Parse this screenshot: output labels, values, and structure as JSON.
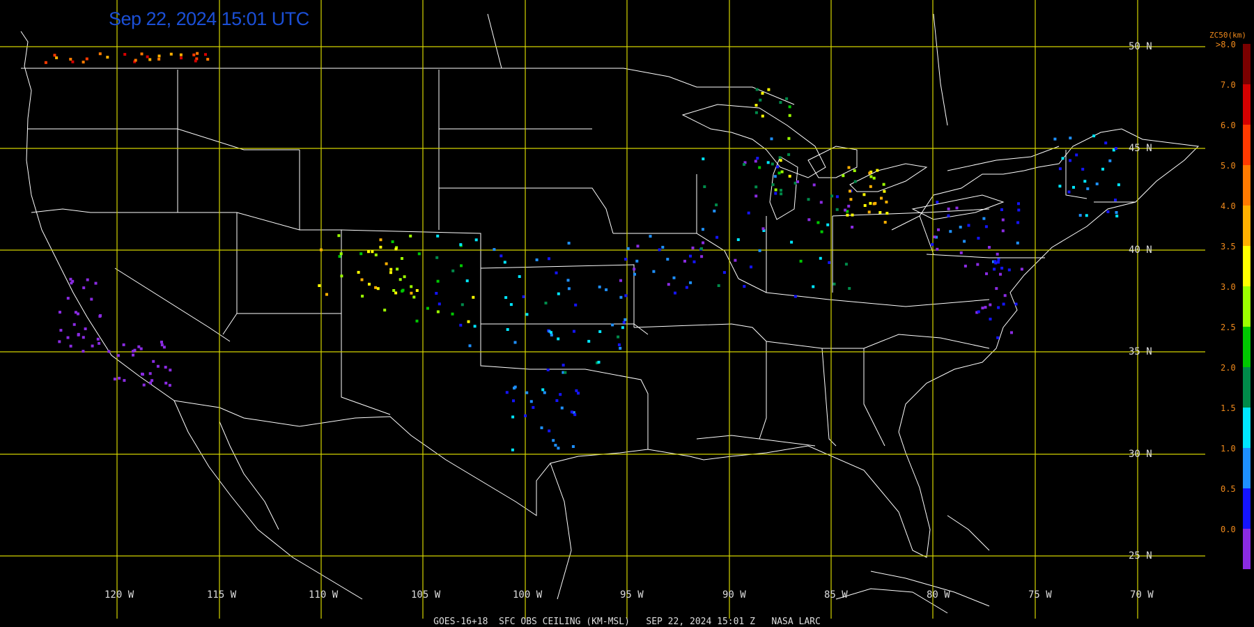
{
  "header": {
    "timestamp": "Sep 22, 2024 15:01 UTC"
  },
  "footer": {
    "caption": "GOES-16+18  SFC OBS CEILING (KM-MSL)   SEP 22, 2024 15:01 Z   NASA LARC"
  },
  "grid": {
    "lat_labels": [
      "50 N",
      "45 N",
      "40 N",
      "35 N",
      "30 N",
      "25 N"
    ],
    "lon_labels": [
      "120 W",
      "115 W",
      "110 W",
      "105 W",
      "100 W",
      "95 W",
      "90 W",
      "85 W",
      "80 W",
      "75 W",
      "70 W"
    ]
  },
  "legend": {
    "title": "ZC50(km)",
    "top_label": ">8.0",
    "labels": [
      "7.0",
      "6.0",
      "5.0",
      "4.0",
      "3.5",
      "3.0",
      "2.5",
      "2.0",
      "1.5",
      "1.0",
      "0.5",
      "0.0"
    ],
    "colors": [
      "#7a0000",
      "#d40000",
      "#ff3a00",
      "#ff7a00",
      "#ffb000",
      "#ffff00",
      "#9cff00",
      "#00c800",
      "#008a4a",
      "#00e6ff",
      "#1e90ff",
      "#1414ff",
      "#8a2be2"
    ]
  }
}
